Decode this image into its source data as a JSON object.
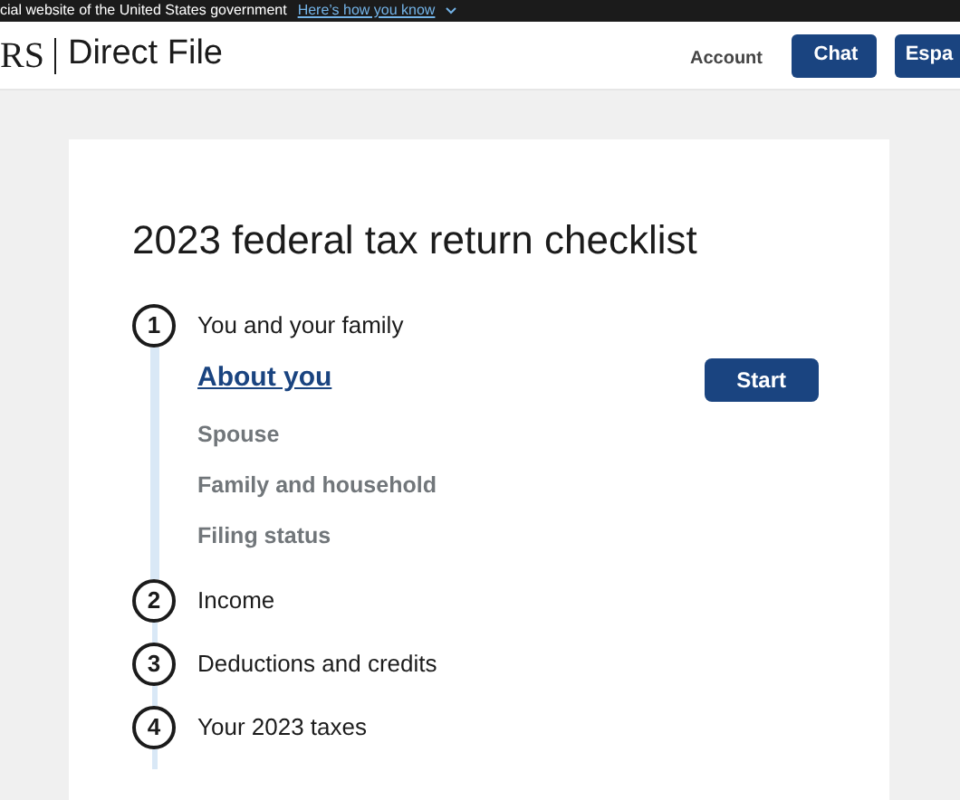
{
  "banner": {
    "text": "cial website of the United States government",
    "link": "Here’s how you know"
  },
  "header": {
    "logo": "RS",
    "product": "Direct File",
    "account": "Account",
    "buttons": [
      "Chat",
      "Espa"
    ]
  },
  "checklist": {
    "title": "2023 federal tax return checklist",
    "sections": [
      {
        "number": "1",
        "title": "You and your family",
        "subsections": [
          {
            "label": "About you",
            "kind": "current",
            "action": "Start"
          },
          {
            "label": "Spouse",
            "kind": "upcoming"
          },
          {
            "label": "Family and household",
            "kind": "upcoming"
          },
          {
            "label": "Filing status",
            "kind": "upcoming"
          }
        ]
      },
      {
        "number": "2",
        "title": "Income"
      },
      {
        "number": "3",
        "title": "Deductions and credits"
      },
      {
        "number": "4",
        "title": "Your 2023 taxes"
      }
    ]
  }
}
